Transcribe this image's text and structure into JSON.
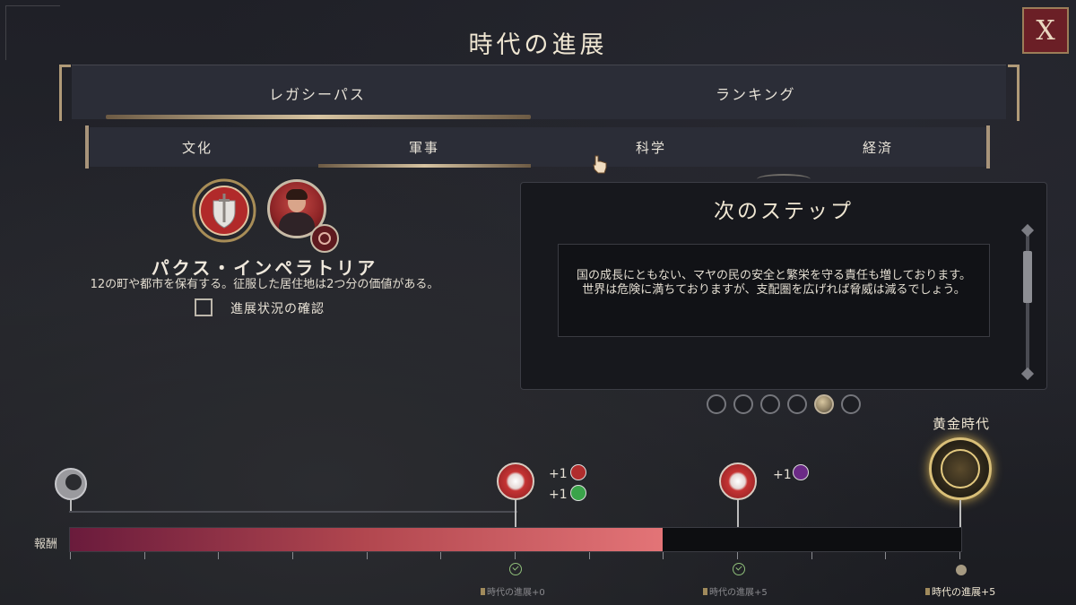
{
  "title": "時代の進展",
  "close_label": "X",
  "main_tabs": [
    "レガシーパス",
    "ランキング"
  ],
  "sub_tabs": [
    "文化",
    "軍事",
    "科学",
    "経済"
  ],
  "selected_main_tab": "レガシーパス",
  "selected_sub_tab": "軍事",
  "goal": {
    "name": "パクス・インペラトリア",
    "description": "12の町や都市を保有する。征服した居住地は2つ分の価値がある。",
    "progress_check_label": "進展状況の確認"
  },
  "next_step": {
    "title": "次のステップ",
    "text": "国の成長にともない、マヤの民の安全と繁栄を守る責任も増しております。世界は危険に満ちておりますが、支配圏を広げれば脅威は減るでしょう。",
    "page_count": 6,
    "current_page": 5
  },
  "timeline": {
    "reward_label": "報酬",
    "golden_age_label": "黄金時代",
    "progress_fraction": 0.665,
    "milestones": [
      {
        "bonus_1": "+1",
        "bonus_2": "+1",
        "age_points": "時代の進展+0"
      },
      {
        "bonus_1": "+1",
        "age_points": "時代の進展+5"
      },
      {
        "age_points": "時代の進展+5"
      }
    ]
  },
  "colors": {
    "accent_gold": "#d7c4a2",
    "bar_start": "#6a1b3c",
    "bar_end": "#e37477",
    "close_bg": "#6b1f26"
  }
}
